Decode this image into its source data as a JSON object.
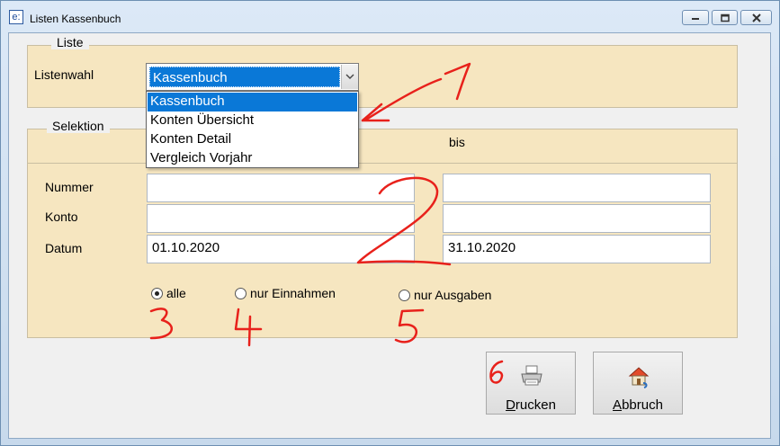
{
  "window": {
    "title": "Listen Kassenbuch",
    "icon_text": "e:"
  },
  "liste": {
    "legend": "Liste",
    "label": "Listenwahl",
    "selected": "Kassenbuch",
    "options": [
      "Kassenbuch",
      "Konten Übersicht",
      "Konten Detail",
      "Vergleich Vorjahr"
    ]
  },
  "selektion": {
    "legend": "Selektion",
    "bis_label": "bis",
    "rows": [
      {
        "label": "Nummer",
        "from": "",
        "to": ""
      },
      {
        "label": "Konto",
        "from": "",
        "to": ""
      },
      {
        "label": "Datum",
        "from": "01.10.2020",
        "to": "31.10.2020"
      }
    ],
    "radios": [
      {
        "label": "alle",
        "checked": true
      },
      {
        "label": "nur Einnahmen",
        "checked": false
      },
      {
        "label": "nur Ausgaben",
        "checked": false
      }
    ]
  },
  "buttons": {
    "print_label": "Drucken",
    "cancel_label": "Abbruch"
  },
  "annotations": [
    "1",
    "2",
    "3",
    "4",
    "5",
    "6"
  ],
  "colors": {
    "selection": "#0a78d7",
    "panel": "#f6e6c0",
    "annotation": "#e8211b"
  }
}
